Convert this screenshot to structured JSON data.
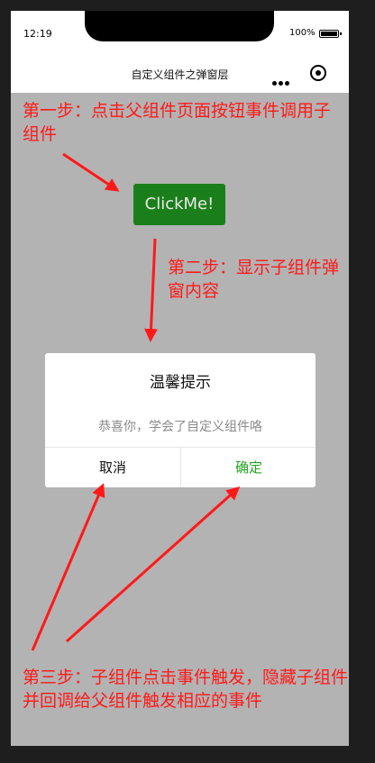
{
  "status_bar": {
    "time": "12:19",
    "battery": "100%"
  },
  "navbar": {
    "title": "自定义组件之弹窗层",
    "more_icon": "more-dots-icon",
    "record_icon": "record-icon"
  },
  "annotations": {
    "step1": "第一步：点击父组件页面按钮事件调用子组件",
    "step2": "第二步：显示子组件弹窗内容",
    "step3": "第三步：子组件点击事件触发，隐藏子组件并回调给父组件触发相应的事件"
  },
  "main": {
    "button_label": "ClickMe!"
  },
  "dialog": {
    "title": "温馨提示",
    "content": "恭喜你，学会了自定义组件咯",
    "cancel_label": "取消",
    "confirm_label": "确定"
  },
  "colors": {
    "page_bg": "#b3b3b3",
    "button_bg": "#1a7f1a",
    "annotation": "#ff1a1a",
    "confirm": "#21a121"
  }
}
